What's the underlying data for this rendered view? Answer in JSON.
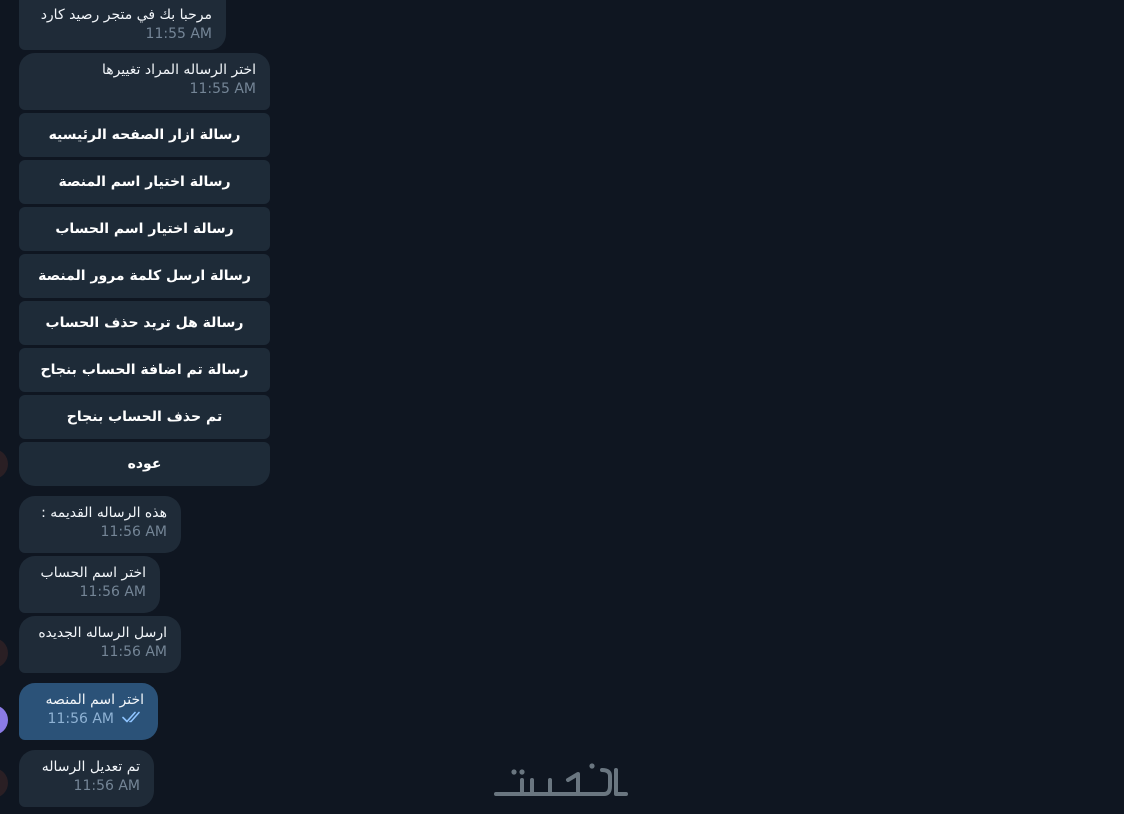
{
  "messages": [
    {
      "text": "مرحبا بك في متجر رصيد كارد",
      "time": "11:55 AM"
    },
    {
      "text": "اختر الرساله المراد تغييرها",
      "time": "11:55 AM"
    },
    {
      "text": "هذه الرساله القديمه :",
      "time": "11:56 AM"
    },
    {
      "text": "اختر اسم الحساب",
      "time": "11:56 AM"
    },
    {
      "text": "ارسل الرساله الجديده",
      "time": "11:56 AM"
    },
    {
      "text": "اختر اسم المنصه",
      "time": "11:56 AM",
      "outgoing": true,
      "status": "read"
    },
    {
      "text": "تم تعديل الرساله",
      "time": "11:56 AM"
    }
  ],
  "keyboard": [
    "رسالة ازار الصفحه الرئيسيه",
    "رسالة اختيار اسم المنصة",
    "رسالة اختيار اسم الحساب",
    "رسالة ارسل كلمة مرور المنصة",
    "رسالة هل تريد حذف الحساب",
    "رسالة تم اضافة الحساب بنجاح",
    "تم حذف الحساب بنجاح",
    "عوده"
  ],
  "watermark": {
    "name": "khamsat-logo",
    "text": "خمسات"
  },
  "icons": {
    "read_ticks": "double-check-icon",
    "avatar": "avatar"
  },
  "colors": {
    "background": "#0f1621",
    "bubble_in": "#1f2b38",
    "bubble_out": "#2b5278",
    "time": "#748596",
    "tick": "#8fc4ff"
  }
}
